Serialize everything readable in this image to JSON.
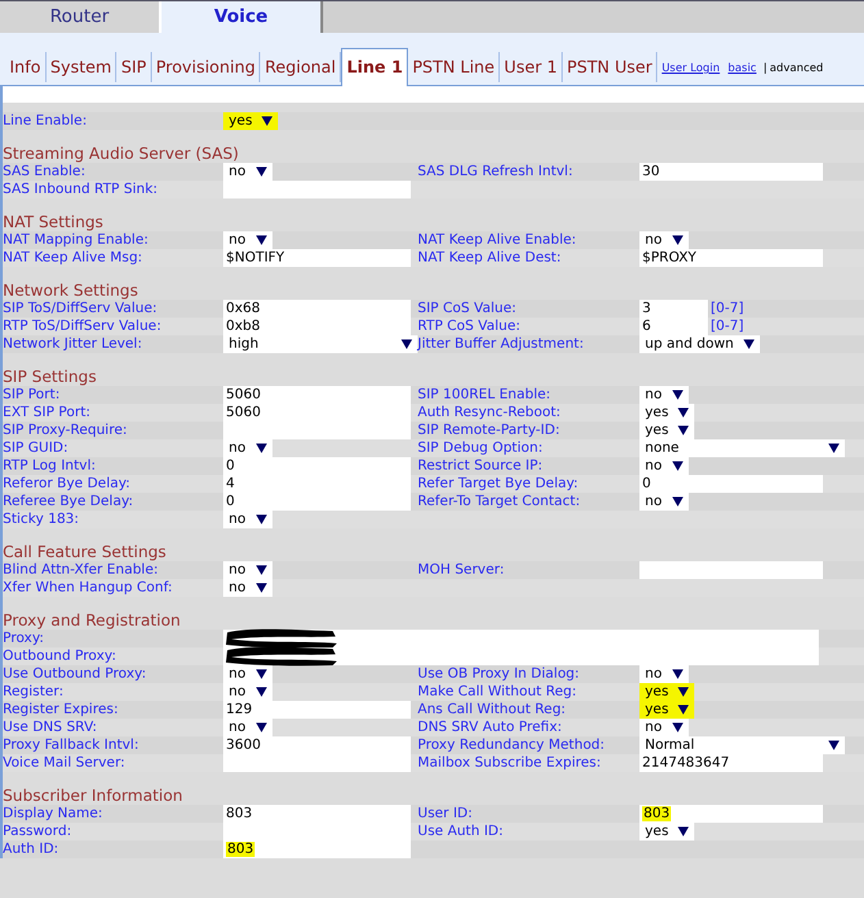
{
  "top_tabs": [
    {
      "label": "Router",
      "selected": false
    },
    {
      "label": "Voice",
      "selected": true
    }
  ],
  "sub_tabs": [
    {
      "label": "Info",
      "selected": false
    },
    {
      "label": "System",
      "selected": false
    },
    {
      "label": "SIP",
      "selected": false
    },
    {
      "label": "Provisioning",
      "selected": false
    },
    {
      "label": "Regional",
      "selected": false
    },
    {
      "label": "Line 1",
      "selected": true
    },
    {
      "label": "PSTN Line",
      "selected": false
    },
    {
      "label": "User 1",
      "selected": false
    },
    {
      "label": "PSTN User",
      "selected": false
    }
  ],
  "links": [
    {
      "label": "User Login"
    },
    {
      "label": "basic"
    }
  ],
  "mode_separator": "|",
  "mode_current": "advanced",
  "sections": [
    {
      "rows": [
        {
          "cells": [
            {
              "label": "Line Enable:",
              "field": {
                "kind": "select",
                "value": "yes",
                "highlighted": true
              }
            }
          ]
        }
      ]
    },
    {
      "title": "Streaming Audio Server (SAS)",
      "rows": [
        {
          "cells": [
            {
              "label": "SAS Enable:",
              "field": {
                "kind": "select",
                "value": "no"
              }
            },
            {
              "label": "SAS DLG Refresh Intvl:",
              "field": {
                "kind": "text",
                "value": "30"
              }
            }
          ]
        },
        {
          "cells": [
            {
              "label": "SAS Inbound RTP Sink:",
              "field": {
                "kind": "text"
              }
            }
          ]
        }
      ]
    },
    {
      "title": "NAT Settings",
      "rows": [
        {
          "cells": [
            {
              "label": "NAT Mapping Enable:",
              "field": {
                "kind": "select",
                "value": "no"
              }
            },
            {
              "label": "NAT Keep Alive Enable:",
              "field": {
                "kind": "select",
                "value": "no"
              }
            }
          ]
        },
        {
          "cells": [
            {
              "label": "NAT Keep Alive Msg:",
              "field": {
                "kind": "text",
                "value": "$NOTIFY"
              }
            },
            {
              "label": "NAT Keep Alive Dest:",
              "field": {
                "kind": "text",
                "value": "$PROXY"
              }
            }
          ]
        }
      ]
    },
    {
      "title": "Network Settings",
      "rows": [
        {
          "cells": [
            {
              "label": "SIP ToS/DiffServ Value:",
              "field": {
                "kind": "text",
                "value": "0x68"
              }
            },
            {
              "label": "SIP CoS Value:",
              "field": {
                "kind": "text",
                "value": "3",
                "note": "[0-7]"
              }
            }
          ]
        },
        {
          "cells": [
            {
              "label": "RTP ToS/DiffServ Value:",
              "field": {
                "kind": "text",
                "value": "0xb8"
              }
            },
            {
              "label": "RTP CoS Value:",
              "field": {
                "kind": "text",
                "value": "6",
                "note": "[0-7]"
              }
            }
          ]
        },
        {
          "cells": [
            {
              "label": "Network Jitter Level:",
              "field": {
                "kind": "select",
                "value": "high",
                "wide": true
              }
            },
            {
              "label": "Jitter Buffer Adjustment:",
              "field": {
                "kind": "select",
                "value": "up and down"
              }
            }
          ]
        }
      ]
    },
    {
      "title": "SIP Settings",
      "rows": [
        {
          "cells": [
            {
              "label": "SIP Port:",
              "field": {
                "kind": "text",
                "value": "5060"
              }
            },
            {
              "label": "SIP 100REL Enable:",
              "field": {
                "kind": "select",
                "value": "no"
              }
            }
          ]
        },
        {
          "cells": [
            {
              "label": "EXT SIP Port:",
              "field": {
                "kind": "text",
                "value": "5060"
              }
            },
            {
              "label": "Auth Resync-Reboot:",
              "field": {
                "kind": "select",
                "value": "yes"
              }
            }
          ]
        },
        {
          "cells": [
            {
              "label": "SIP Proxy-Require:",
              "field": {
                "kind": "text"
              }
            },
            {
              "label": "SIP Remote-Party-ID:",
              "field": {
                "kind": "select",
                "value": "yes"
              }
            }
          ]
        },
        {
          "cells": [
            {
              "label": "SIP GUID:",
              "field": {
                "kind": "select",
                "value": "no"
              }
            },
            {
              "label": "SIP Debug Option:",
              "field": {
                "kind": "select",
                "value": "none",
                "wide": true
              }
            }
          ]
        },
        {
          "cells": [
            {
              "label": "RTP Log Intvl:",
              "field": {
                "kind": "text",
                "value": "0"
              }
            },
            {
              "label": "Restrict Source IP:",
              "field": {
                "kind": "select",
                "value": "no"
              }
            }
          ]
        },
        {
          "cells": [
            {
              "label": "Referor Bye Delay:",
              "field": {
                "kind": "text",
                "value": "4"
              }
            },
            {
              "label": "Refer Target Bye Delay:",
              "field": {
                "kind": "text",
                "value": "0"
              }
            }
          ]
        },
        {
          "cells": [
            {
              "label": "Referee Bye Delay:",
              "field": {
                "kind": "text",
                "value": "0"
              }
            },
            {
              "label": "Refer-To Target Contact:",
              "field": {
                "kind": "select",
                "value": "no"
              }
            }
          ]
        },
        {
          "cells": [
            {
              "label": "Sticky 183:",
              "field": {
                "kind": "select",
                "value": "no"
              }
            }
          ]
        }
      ]
    },
    {
      "title": "Call Feature Settings",
      "rows": [
        {
          "cells": [
            {
              "label": "Blind Attn-Xfer Enable:",
              "field": {
                "kind": "select",
                "value": "no"
              }
            },
            {
              "label": "MOH Server:",
              "field": {
                "kind": "text"
              }
            }
          ]
        },
        {
          "cells": [
            {
              "label": "Xfer When Hangup Conf:",
              "field": {
                "kind": "select",
                "value": "no"
              }
            }
          ]
        }
      ]
    },
    {
      "title": "Proxy and Registration",
      "rows": [
        {
          "cells": [
            {
              "label": "Proxy:",
              "field": {
                "kind": "text",
                "span": true,
                "redacted": true
              }
            }
          ]
        },
        {
          "cells": [
            {
              "label": "Outbound Proxy:",
              "field": {
                "kind": "text",
                "span": true,
                "redacted": true
              }
            }
          ]
        },
        {
          "cells": [
            {
              "label": "Use Outbound Proxy:",
              "field": {
                "kind": "select",
                "value": "no"
              }
            },
            {
              "label": "Use OB Proxy In Dialog:",
              "field": {
                "kind": "select",
                "value": "no"
              }
            }
          ]
        },
        {
          "cells": [
            {
              "label": "Register:",
              "field": {
                "kind": "select",
                "value": "no"
              }
            },
            {
              "label": "Make Call Without Reg:",
              "field": {
                "kind": "select",
                "value": "yes",
                "highlighted": true
              }
            }
          ]
        },
        {
          "cells": [
            {
              "label": "Register Expires:",
              "field": {
                "kind": "text",
                "value": "129"
              }
            },
            {
              "label": "Ans Call Without Reg:",
              "field": {
                "kind": "select",
                "value": "yes",
                "highlighted": true
              }
            }
          ]
        },
        {
          "cells": [
            {
              "label": "Use DNS SRV:",
              "field": {
                "kind": "select",
                "value": "no"
              }
            },
            {
              "label": "DNS SRV Auto Prefix:",
              "field": {
                "kind": "select",
                "value": "no"
              }
            }
          ]
        },
        {
          "cells": [
            {
              "label": "Proxy Fallback Intvl:",
              "field": {
                "kind": "text",
                "value": "3600"
              }
            },
            {
              "label": "Proxy Redundancy Method:",
              "field": {
                "kind": "select",
                "value": "Normal",
                "wide": true
              }
            }
          ]
        },
        {
          "cells": [
            {
              "label": "Voice Mail Server:",
              "field": {
                "kind": "text"
              }
            },
            {
              "label": "Mailbox Subscribe Expires:",
              "field": {
                "kind": "text",
                "value": "2147483647"
              }
            }
          ]
        }
      ]
    },
    {
      "title": "Subscriber Information",
      "rows": [
        {
          "cells": [
            {
              "label": "Display Name:",
              "field": {
                "kind": "text",
                "value": "803"
              }
            },
            {
              "label": "User ID:",
              "field": {
                "kind": "text",
                "value": "803",
                "highlighted": true
              }
            }
          ]
        },
        {
          "cells": [
            {
              "label": "Password:",
              "field": {
                "kind": "text"
              }
            },
            {
              "label": "Use Auth ID:",
              "field": {
                "kind": "select",
                "value": "yes"
              }
            }
          ]
        },
        {
          "cells": [
            {
              "label": "Auth ID:",
              "field": {
                "kind": "text",
                "value": "803",
                "highlighted": true
              }
            }
          ]
        }
      ]
    }
  ]
}
